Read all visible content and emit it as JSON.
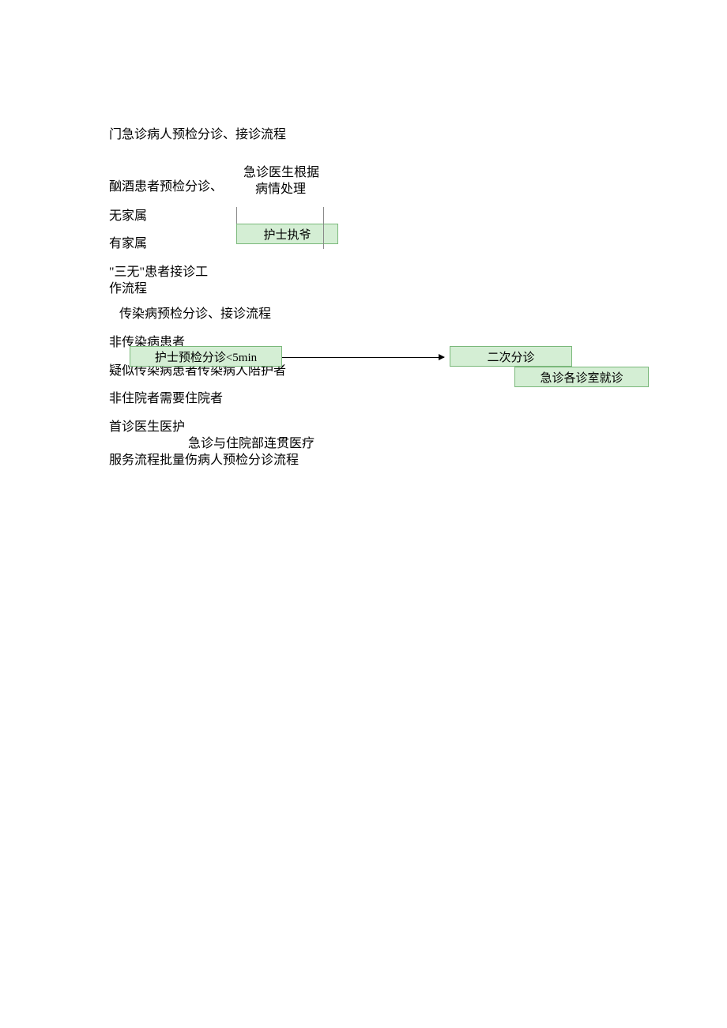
{
  "title": "门急诊病人预检分诊、接诊流程",
  "texts": {
    "t1": "酗酒患者预检分诊、",
    "t2": "急诊医生根据",
    "t3": "病情处理",
    "t4": "无家属",
    "t5": "有家属",
    "t6": "\"三无\"患者接诊工",
    "t7": "作流程",
    "t8": "传染病预检分诊、接诊流程",
    "t9": "非传染病患者",
    "t10": "疑似传染病患者传染病人陪护者",
    "t11": "非住院者需要住院者",
    "t12": "首诊医生医护",
    "t13": "急诊与住院部连贯医疗",
    "t14": "服务流程批量伤病人预检分诊流程"
  },
  "boxes": {
    "b1": "护士执爷",
    "b2": "护士预检分诊<5min",
    "b3": "二次分诊",
    "b4": "急诊各诊室就诊"
  }
}
